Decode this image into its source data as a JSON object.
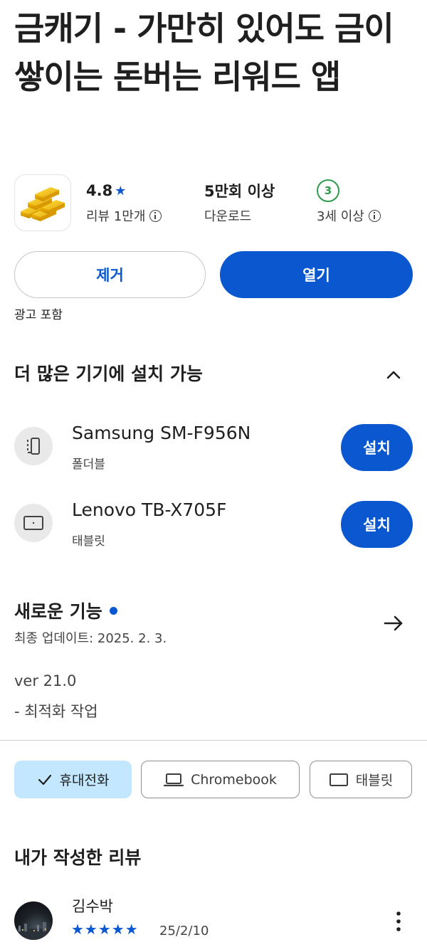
{
  "app": {
    "title": "금캐기 - 가만히 있어도 금이 쌓이는 돈버는 리워드 앱",
    "rating": "4.8",
    "rating_star": "★",
    "reviews": "리뷰 1만개",
    "downloads": "5만회 이상",
    "downloads_label": "다운로드",
    "age_badge": "3",
    "age_label": "3세 이상",
    "icon": "gold-bars-icon"
  },
  "actions": {
    "remove": "제거",
    "open": "열기",
    "ads_note": "광고 포함"
  },
  "devices": {
    "title": "더 많은 기기에 설치 가능",
    "items": [
      {
        "name": "Samsung SM-F956N",
        "type": "폴더블",
        "icon": "foldable-icon",
        "action": "설치"
      },
      {
        "name": "Lenovo TB-X705F",
        "type": "태블릿",
        "icon": "tablet-icon",
        "action": "설치"
      }
    ]
  },
  "whats_new": {
    "title": "새로운 기능",
    "updated": "최종 업데이트: 2025. 2. 3.",
    "lines": [
      "ver 21.0",
      "- 최적화 작업"
    ]
  },
  "chips": [
    {
      "label": "휴대전화",
      "selected": true,
      "icon": "check-icon"
    },
    {
      "label": "Chromebook",
      "selected": false,
      "icon": "laptop-icon"
    },
    {
      "label": "태블릿",
      "selected": false,
      "icon": "tablet-icon"
    }
  ],
  "my_review": {
    "title": "내가 작성한 리뷰",
    "author": "김수박",
    "stars": "★★★★★",
    "date": "25/2/10"
  },
  "colors": {
    "accent": "#0b57d0",
    "chip_selected": "#c2e7ff",
    "age_green": "#2e9a4c"
  }
}
